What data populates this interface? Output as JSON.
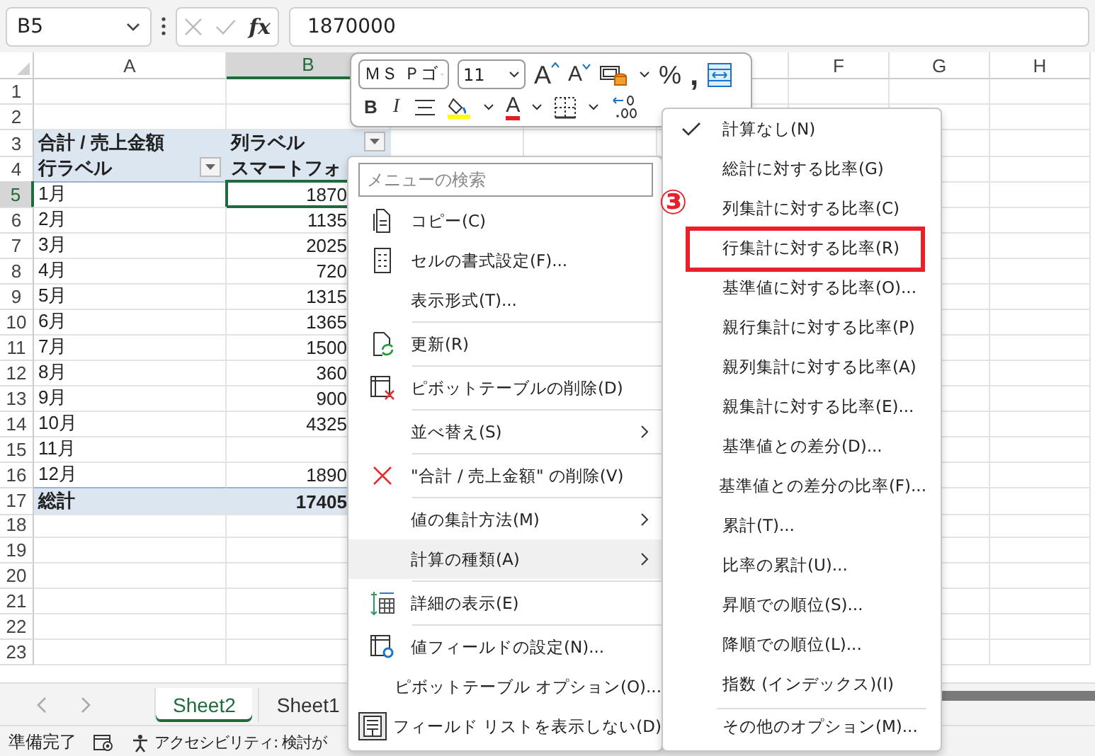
{
  "name_box": {
    "value": "B5"
  },
  "formula_bar": {
    "function_label": "fx",
    "value": "1870000"
  },
  "columns": [
    {
      "label": "A",
      "selected": false
    },
    {
      "label": "B",
      "selected": true
    },
    {
      "label": "F",
      "selected": false
    },
    {
      "label": "G",
      "selected": false
    },
    {
      "label": "H",
      "selected": false
    }
  ],
  "rows": [
    {
      "number": "1",
      "kind": "blank",
      "selected": false
    },
    {
      "number": "2",
      "kind": "blank",
      "selected": false
    },
    {
      "number": "3",
      "kind": "pivot-header",
      "selected": false,
      "a": "合計 / 売上金額",
      "b": "列ラベル",
      "a_filter": false,
      "b_filter": true
    },
    {
      "number": "4",
      "kind": "pivot-header",
      "selected": false,
      "a": "行ラベル",
      "b": "スマートフォ",
      "a_filter": true,
      "b_filter": false
    },
    {
      "number": "5",
      "kind": "data",
      "selected": true,
      "a": "1月",
      "b": "1870"
    },
    {
      "number": "6",
      "kind": "data",
      "selected": false,
      "a": "2月",
      "b": "1135"
    },
    {
      "number": "7",
      "kind": "data",
      "selected": false,
      "a": "3月",
      "b": "2025"
    },
    {
      "number": "8",
      "kind": "data",
      "selected": false,
      "a": "4月",
      "b": "720"
    },
    {
      "number": "9",
      "kind": "data",
      "selected": false,
      "a": "5月",
      "b": "1315"
    },
    {
      "number": "10",
      "kind": "data",
      "selected": false,
      "a": "6月",
      "b": "1365"
    },
    {
      "number": "11",
      "kind": "data",
      "selected": false,
      "a": "7月",
      "b": "1500"
    },
    {
      "number": "12",
      "kind": "data",
      "selected": false,
      "a": "8月",
      "b": "360"
    },
    {
      "number": "13",
      "kind": "data",
      "selected": false,
      "a": "9月",
      "b": "900"
    },
    {
      "number": "14",
      "kind": "data",
      "selected": false,
      "a": "10月",
      "b": "4325"
    },
    {
      "number": "15",
      "kind": "data",
      "selected": false,
      "a": "11月"
    },
    {
      "number": "16",
      "kind": "data",
      "selected": false,
      "a": "12月",
      "b": "1890"
    },
    {
      "number": "17",
      "kind": "total",
      "selected": false,
      "a": "総計",
      "b": "17405"
    },
    {
      "number": "18",
      "kind": "blank",
      "selected": false
    },
    {
      "number": "19",
      "kind": "blank",
      "selected": false
    },
    {
      "number": "20",
      "kind": "blank",
      "selected": false
    },
    {
      "number": "21",
      "kind": "blank",
      "selected": false
    },
    {
      "number": "22",
      "kind": "blank",
      "selected": false
    },
    {
      "number": "23",
      "kind": "blank",
      "selected": false
    }
  ],
  "mini_toolbar": {
    "font": "ＭＳ Ｐゴ",
    "size": "11",
    "grow_label": "A",
    "shrink_label": "A",
    "percent": "%",
    "comma": ",",
    "bold": "B",
    "italic": "I",
    "font_color_label": "A"
  },
  "context_menu": {
    "search": {
      "placeholder": "メニューの検索"
    },
    "items": [
      {
        "label": "コピー(C)",
        "separator_before": false,
        "submenu": false,
        "highlighted": false
      },
      {
        "label": "セルの書式設定(F)...",
        "separator_before": false,
        "submenu": false,
        "highlighted": false
      },
      {
        "label": "表示形式(T)...",
        "separator_before": false,
        "submenu": false,
        "highlighted": false
      },
      {
        "label": "更新(R)",
        "separator_before": true,
        "submenu": false,
        "highlighted": false
      },
      {
        "label": "ピボットテーブルの削除(D)",
        "separator_before": true,
        "submenu": false,
        "highlighted": false
      },
      {
        "label": "並べ替え(S)",
        "separator_before": true,
        "submenu": true,
        "highlighted": false
      },
      {
        "label": "\"合計 / 売上金額\" の削除(V)",
        "separator_before": true,
        "submenu": false,
        "highlighted": false
      },
      {
        "label": "値の集計方法(M)",
        "separator_before": true,
        "submenu": true,
        "highlighted": false
      },
      {
        "label": "計算の種類(A)",
        "separator_before": false,
        "submenu": true,
        "highlighted": true
      },
      {
        "label": "詳細の表示(E)",
        "separator_before": true,
        "submenu": false,
        "highlighted": false
      },
      {
        "label": "値フィールドの設定(N)...",
        "separator_before": true,
        "submenu": false,
        "highlighted": false
      },
      {
        "label": "ピボットテーブル オプション(O)...",
        "separator_before": false,
        "submenu": false,
        "highlighted": false
      },
      {
        "label": "フィールド リストを表示しない(D)",
        "separator_before": false,
        "submenu": false,
        "highlighted": false
      }
    ]
  },
  "submenu": {
    "items": [
      {
        "label": "計算なし(N)",
        "checked": true,
        "separator_before": false,
        "marked": false
      },
      {
        "label": "総計に対する比率(G)",
        "checked": false,
        "separator_before": false,
        "marked": false
      },
      {
        "label": "列集計に対する比率(C)",
        "checked": false,
        "separator_before": false,
        "marked": false
      },
      {
        "label": "行集計に対する比率(R)",
        "checked": false,
        "separator_before": false,
        "marked": true
      },
      {
        "label": "基準値に対する比率(O)...",
        "checked": false,
        "separator_before": false,
        "marked": false
      },
      {
        "label": "親行集計に対する比率(P)",
        "checked": false,
        "separator_before": false,
        "marked": false
      },
      {
        "label": "親列集計に対する比率(A)",
        "checked": false,
        "separator_before": false,
        "marked": false
      },
      {
        "label": "親集計に対する比率(E)...",
        "checked": false,
        "separator_before": false,
        "marked": false
      },
      {
        "label": "基準値との差分(D)...",
        "checked": false,
        "separator_before": false,
        "marked": false
      },
      {
        "label": "基準値との差分の比率(F)...",
        "checked": false,
        "separator_before": false,
        "marked": false
      },
      {
        "label": "累計(T)...",
        "checked": false,
        "separator_before": false,
        "marked": false
      },
      {
        "label": "比率の累計(U)...",
        "checked": false,
        "separator_before": false,
        "marked": false
      },
      {
        "label": "昇順での順位(S)...",
        "checked": false,
        "separator_before": false,
        "marked": false
      },
      {
        "label": "降順での順位(L)...",
        "checked": false,
        "separator_before": false,
        "marked": false
      },
      {
        "label": "指数 (インデックス)(I)",
        "checked": false,
        "separator_before": false,
        "marked": false
      },
      {
        "label": "その他のオプション(M)...",
        "checked": false,
        "separator_before": true,
        "marked": false
      }
    ]
  },
  "annotation": {
    "label": "③"
  },
  "sheet_tabs": [
    {
      "label": "Sheet2",
      "selected": true
    },
    {
      "label": "Sheet1",
      "selected": false
    }
  ],
  "status_bar": {
    "ready": "準備完了",
    "accessibility": "アクセシビリティ: 検討が"
  }
}
